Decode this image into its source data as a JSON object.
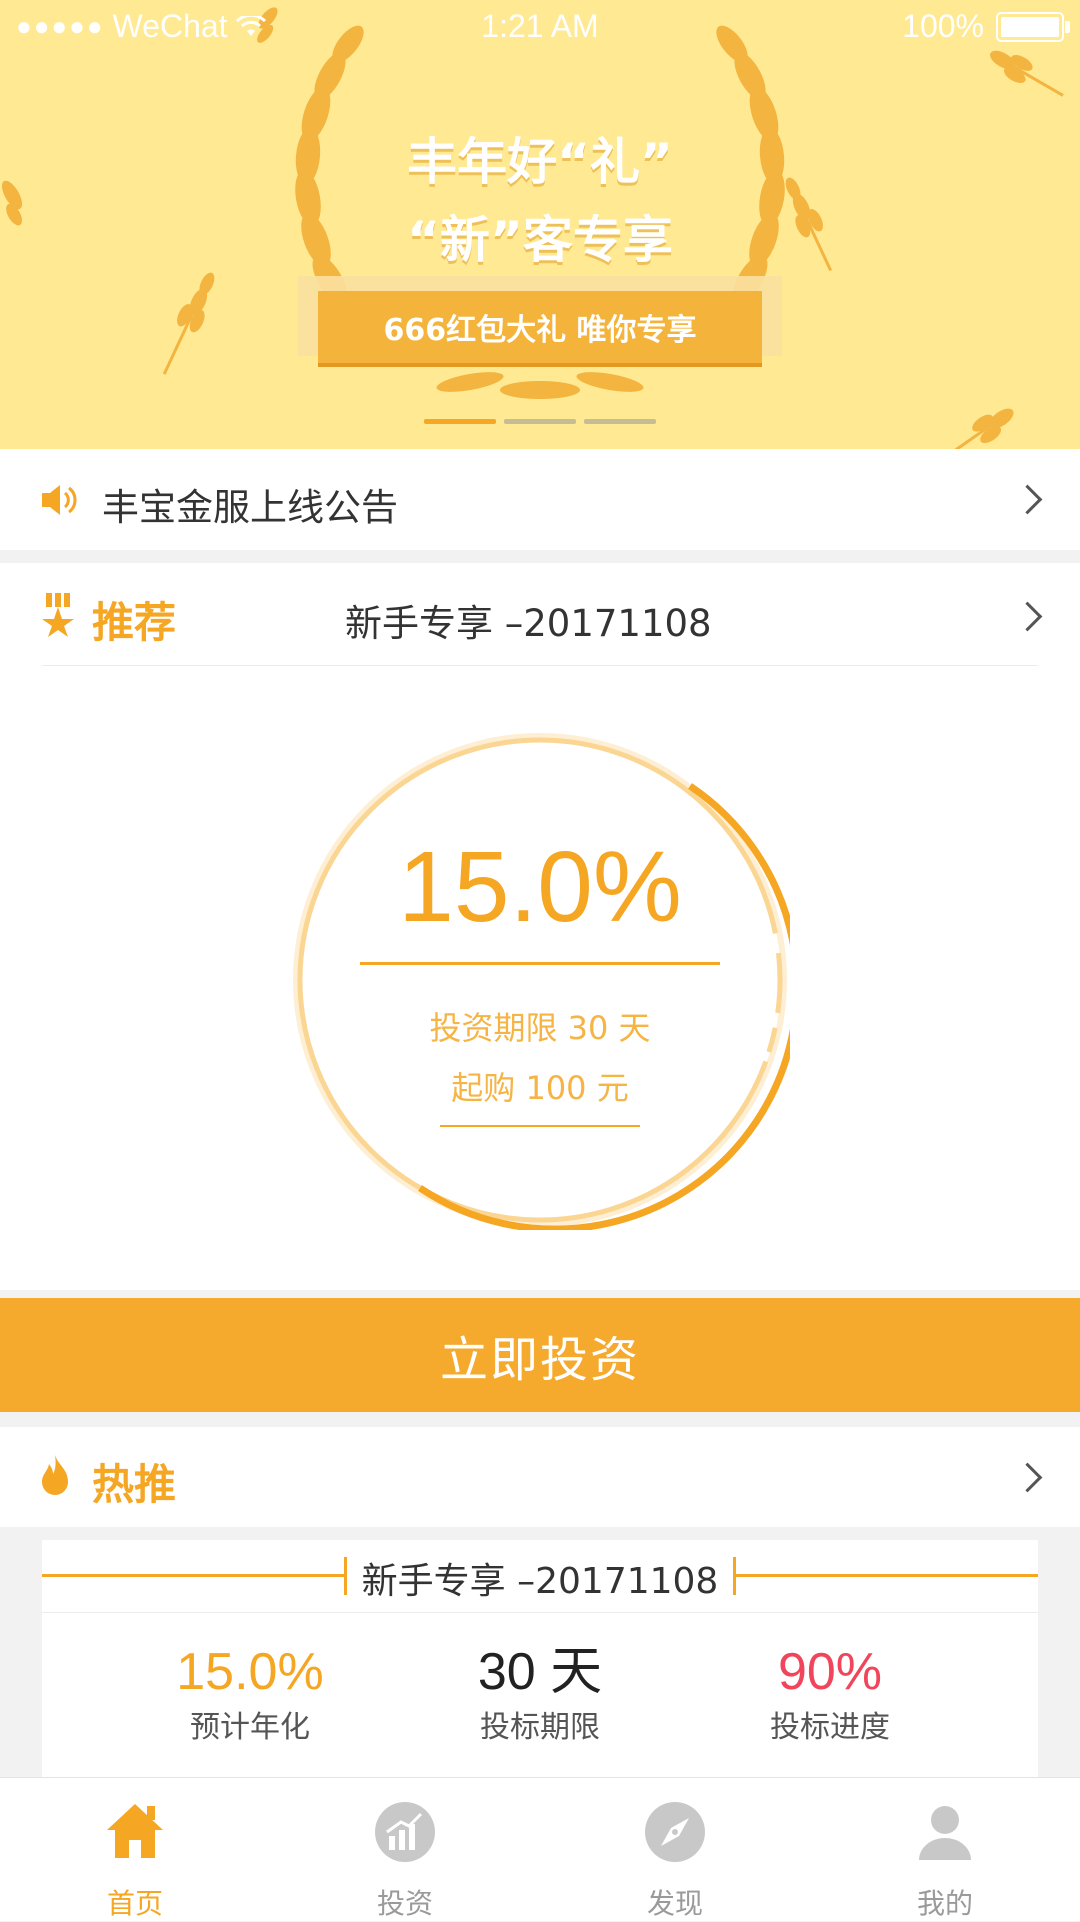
{
  "status_bar": {
    "carrier": "WeChat",
    "time": "1:21 AM",
    "battery": "100%"
  },
  "banner": {
    "title_line1": "丰年好“礼”",
    "title_line2": "“新”客专享",
    "ribbon_text": "666红包大礼  唯你专享",
    "pages": 3,
    "active_page": 1
  },
  "notice": {
    "text": "丰宝金服上线公告"
  },
  "recommend": {
    "section_title": "推荐",
    "product_name": "新手专享 –20171108",
    "rate": "15.0%",
    "term": "投资期限 30 天",
    "min_purchase": "起购 100 元",
    "invest_button": "立即投资"
  },
  "hot": {
    "section_title": "热推",
    "product_name": "新手专享 –20171108",
    "stats": [
      {
        "value": "15.0%",
        "label": "预计年化",
        "color": "#f5a623"
      },
      {
        "value": "30 天",
        "label": "投标期限",
        "color": "#222222"
      },
      {
        "value": "90%",
        "label": "投标进度",
        "color": "#f0455a"
      }
    ]
  },
  "tabbar": {
    "items": [
      {
        "label": "首页",
        "icon": "home-icon",
        "active": true
      },
      {
        "label": "投资",
        "icon": "chart-icon",
        "active": false
      },
      {
        "label": "发现",
        "icon": "compass-icon",
        "active": false
      },
      {
        "label": "我的",
        "icon": "user-icon",
        "active": false
      }
    ]
  },
  "colors": {
    "accent": "#f5a623",
    "banner_bg": "#ffe992",
    "progress_red": "#f0455a"
  }
}
